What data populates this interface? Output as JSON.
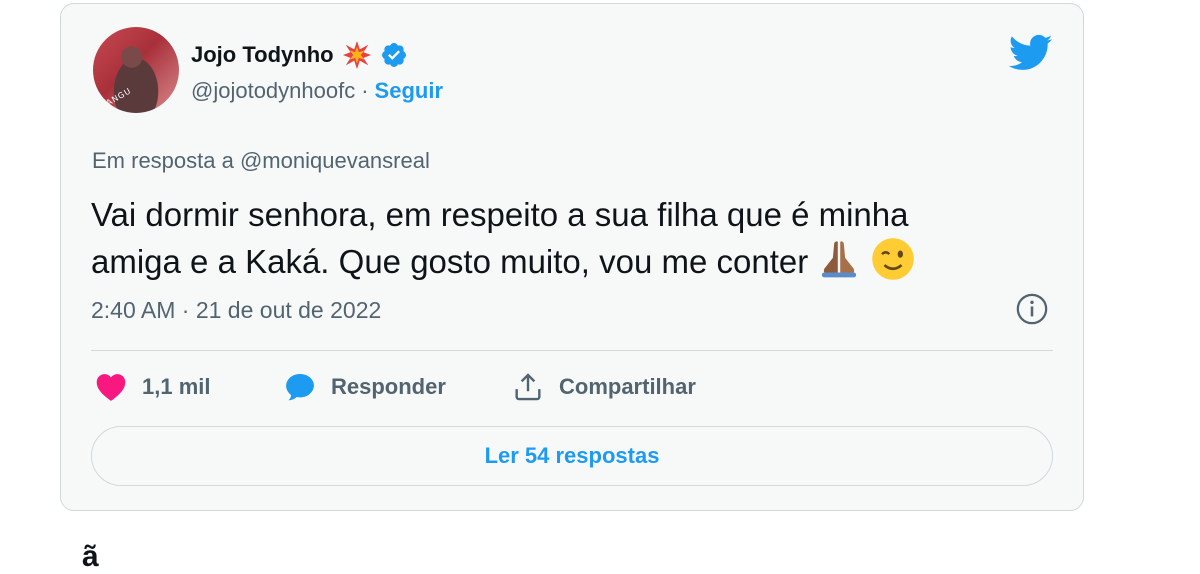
{
  "tweet": {
    "author_name": "Jojo Todynho",
    "handle": "@jojotodynhoofc",
    "separator": "·",
    "follow_label": "Seguir",
    "reply_context_prefix": "Em resposta a",
    "reply_context_mention": "@moniquevansreal",
    "text_line1": "Vai dormir senhora, em respeito a sua filha que é minha",
    "text_line2": "amiga e a Kaká. Que gosto muito, vou me conter",
    "timestamp": "2:40 AM · 21 de out de 2022",
    "likes_count": "1,1 mil",
    "reply_label": "Responder",
    "share_label": "Compartilhar",
    "read_replies_label": "Ler 54 respostas"
  },
  "icons": {
    "name_emoji": "collision-icon",
    "verified": "verified-badge-icon",
    "brand": "twitter-bird-icon",
    "info": "info-icon",
    "like": "heart-icon",
    "reply": "reply-bubble-icon",
    "share": "share-upload-icon",
    "emoji_1": "folded-hands-icon",
    "emoji_2": "winking-face-icon"
  },
  "colors": {
    "accent": "#1d9bf0",
    "like": "#f91880",
    "text": "#0f1419",
    "secondary_text": "#536471",
    "border": "#cfd9de",
    "card_background": "#f7f9f9"
  },
  "below_card_text": "ã"
}
